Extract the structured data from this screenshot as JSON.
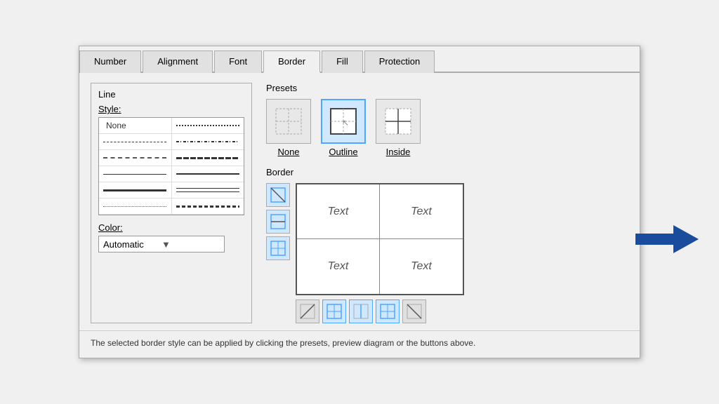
{
  "tabs": [
    {
      "label": "Number",
      "active": false
    },
    {
      "label": "Alignment",
      "active": false
    },
    {
      "label": "Font",
      "active": false
    },
    {
      "label": "Border",
      "active": true
    },
    {
      "label": "Fill",
      "active": false
    },
    {
      "label": "Protection",
      "active": false
    }
  ],
  "line_panel": {
    "title": "Line",
    "style_label": "Style:",
    "color_label": "Color:",
    "color_value": "Automatic"
  },
  "presets": {
    "title": "Presets",
    "items": [
      {
        "label": "None",
        "active": false
      },
      {
        "label": "Outline",
        "active": true
      },
      {
        "label": "Inside",
        "active": false
      }
    ]
  },
  "border": {
    "title": "Border",
    "text_cells": [
      "Text",
      "Text",
      "Text",
      "Text"
    ]
  },
  "footer": {
    "text": "The selected border style can be applied by clicking the presets, preview diagram or the buttons above."
  }
}
